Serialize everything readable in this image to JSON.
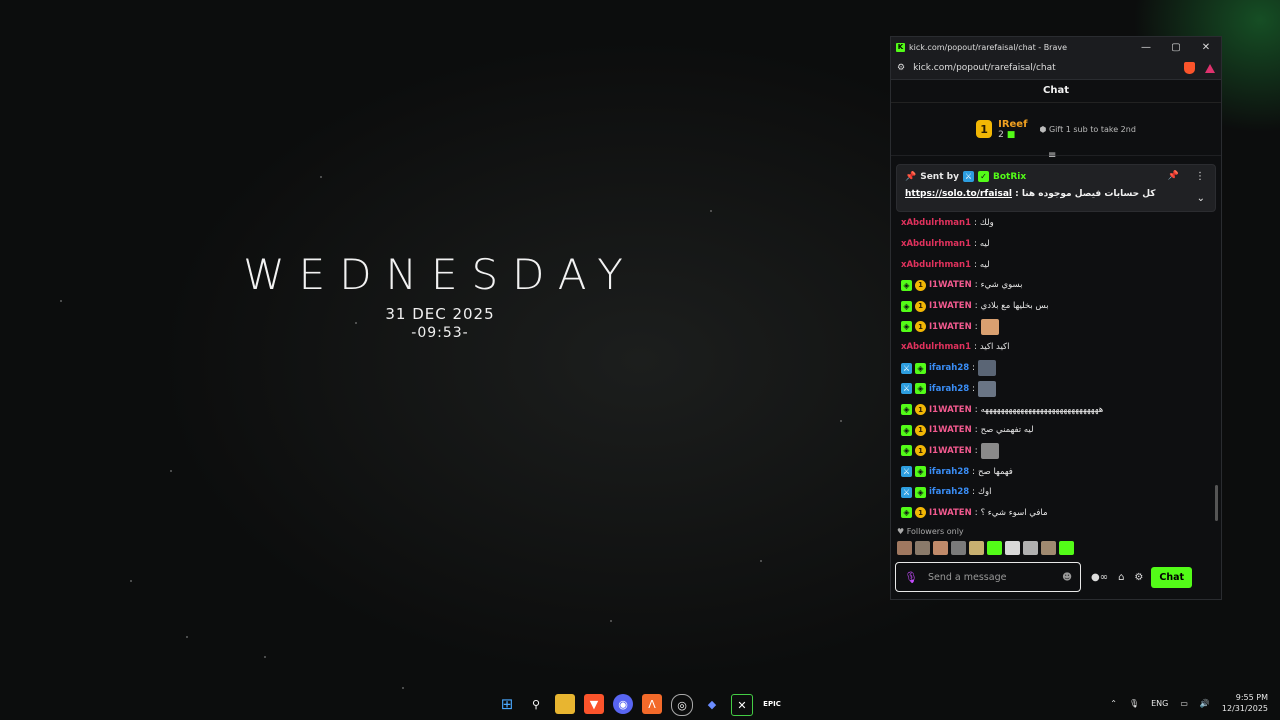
{
  "desktop": {
    "day": "WEDNESDAY",
    "date": "31 DEC 2025",
    "time": "-09:53-"
  },
  "window": {
    "title": "kick.com/popout/rarefaisal/chat - Brave",
    "url": "kick.com/popout/rarefaisal/chat",
    "buttons": {
      "minimize": "—",
      "maximize": "▢",
      "close": "✕"
    }
  },
  "chat": {
    "header": "Chat",
    "leaderboard": {
      "rank": "1",
      "name": "IReef",
      "count": "2",
      "gift_text": "Gift 1 sub to take 2nd"
    },
    "pinned": {
      "sent_by": "Sent by",
      "bot_name": "BotRix",
      "message": "كل حسابات فيصل موجوده هنا : ",
      "link": "https://solo.to/rfaisal"
    },
    "messages": [
      {
        "user": "xAbdulrhman1",
        "style": "red",
        "badges": [],
        "text": "ولك"
      },
      {
        "user": "xAbdulrhman1",
        "style": "red",
        "badges": [],
        "text": "ليه"
      },
      {
        "user": "xAbdulrhman1",
        "style": "red",
        "badges": [],
        "text": "ليه"
      },
      {
        "user": "I1WATEN",
        "style": "pink",
        "badges": [
          "g",
          "s"
        ],
        "text": "بسوي شيء"
      },
      {
        "user": "I1WATEN",
        "style": "pink",
        "badges": [
          "g",
          "s"
        ],
        "text": "بس بخليها مع بلادي"
      },
      {
        "user": "I1WATEN",
        "style": "pink",
        "badges": [
          "g",
          "s"
        ],
        "text": "",
        "emote": "#d9a070"
      },
      {
        "user": "xAbdulrhman1",
        "style": "red",
        "badges": [],
        "text": "اكيد اكيد"
      },
      {
        "user": "ifarah28",
        "style": "blue",
        "badges": [
          "b",
          "g"
        ],
        "text": "",
        "emote": "#5a6575"
      },
      {
        "user": "ifarah28",
        "style": "blue",
        "badges": [
          "b",
          "g"
        ],
        "text": "",
        "emote": "#6a7585"
      },
      {
        "user": "I1WATEN",
        "style": "pink",
        "badges": [
          "g",
          "s"
        ],
        "text": "ههههههههههههههههههههههههههههههه"
      },
      {
        "user": "I1WATEN",
        "style": "pink",
        "badges": [
          "g",
          "s"
        ],
        "text": "ليه تفهمني صح"
      },
      {
        "user": "I1WATEN",
        "style": "pink",
        "badges": [
          "g",
          "s"
        ],
        "text": "",
        "emote": "#8a8a8a"
      },
      {
        "user": "ifarah28",
        "style": "blue",
        "badges": [
          "b",
          "g"
        ],
        "text": "فهمها صح"
      },
      {
        "user": "ifarah28",
        "style": "blue",
        "badges": [
          "b",
          "g"
        ],
        "text": "اوك"
      },
      {
        "user": "I1WATEN",
        "style": "pink",
        "badges": [
          "g",
          "s"
        ],
        "text": "مافي اسوء شيء ؟"
      }
    ],
    "followers_only": "Followers only",
    "emote_colors": [
      "#a07860",
      "#8a7a6a",
      "#c08a6a",
      "#7a7a7a",
      "#c8b070",
      "#53fc18",
      "#d8d8d8",
      "#b0b0b0",
      "#a08a70",
      "#53fc18"
    ],
    "input_placeholder": "Send a message",
    "send_label": "Chat"
  },
  "taskbar": {
    "lang": "ENG",
    "time": "9:55 PM",
    "date": "12/31/2025"
  }
}
